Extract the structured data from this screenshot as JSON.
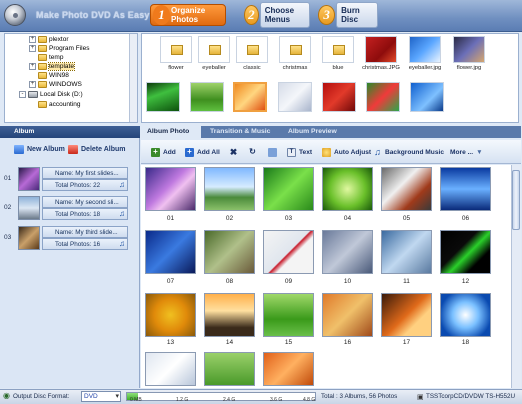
{
  "app": {
    "title": "Make Photo DVD As Easy as",
    "steps": [
      {
        "num": "1",
        "label": "Organize Photos"
      },
      {
        "num": "2",
        "label": "Choose Menus"
      },
      {
        "num": "3",
        "label": "Burn Disc"
      }
    ]
  },
  "tree": {
    "items": [
      {
        "label": "plextor",
        "expander": "+"
      },
      {
        "label": "Program Files",
        "expander": "+"
      },
      {
        "label": "temp",
        "expander": ""
      },
      {
        "label": "template",
        "expander": "+"
      },
      {
        "label": "WIN98",
        "expander": ""
      },
      {
        "label": "WINDOWS",
        "expander": "+"
      },
      {
        "label": "Local Disk (D:)",
        "expander": "-"
      },
      {
        "label": "accounting",
        "expander": ""
      }
    ]
  },
  "source_thumbs": [
    {
      "label": "flower",
      "kind": "folder"
    },
    {
      "label": "eyeballer",
      "kind": "folder"
    },
    {
      "label": "classic",
      "kind": "folder"
    },
    {
      "label": "christmas",
      "kind": "folder"
    },
    {
      "label": "blue",
      "kind": "folder"
    },
    {
      "label": "christmas.JPG",
      "kind": "image"
    },
    {
      "label": "eyeballer.jpg",
      "kind": "image"
    },
    {
      "label": "flower.jpg",
      "kind": "image"
    }
  ],
  "album_panel": {
    "tab": "Album",
    "new_album": "New Album",
    "delete_album": "Delete Album",
    "albums": [
      {
        "num": "01",
        "name": "Name: My first slides...",
        "total": "Total Photos: 22"
      },
      {
        "num": "02",
        "name": "Name: My second sli...",
        "total": "Total Photos: 18"
      },
      {
        "num": "03",
        "name": "Name: My third slide...",
        "total": "Total Photos: 16"
      }
    ]
  },
  "tabs": [
    "Album Photo",
    "Transition & Music",
    "Album Preview"
  ],
  "toolbar": {
    "add": "Add",
    "add_all": "Add All",
    "text": "Text",
    "auto_adjust": "Auto Adjust",
    "background_music": "Background Music",
    "more": "More ..."
  },
  "photos": [
    "01",
    "02",
    "03",
    "04",
    "05",
    "06",
    "07",
    "08",
    "09",
    "10",
    "11",
    "12",
    "13",
    "14",
    "15",
    "16",
    "17",
    "18"
  ],
  "status": {
    "output_label": "Output Disc Format:",
    "format": "DVD",
    "ticks": [
      "0 MB",
      "1.2 G",
      "2.4 G",
      "3.6 G",
      "4.8 G"
    ],
    "capacity_fraction": 0.06,
    "total": "Total : 3 Albums, 56 Photos",
    "drive": "TSSTcorpCD/DVDW TS-H552U"
  },
  "colors": {
    "header": "#6f8fc0",
    "active_step": "#f07a1c",
    "panel_tab": "#25457a"
  }
}
